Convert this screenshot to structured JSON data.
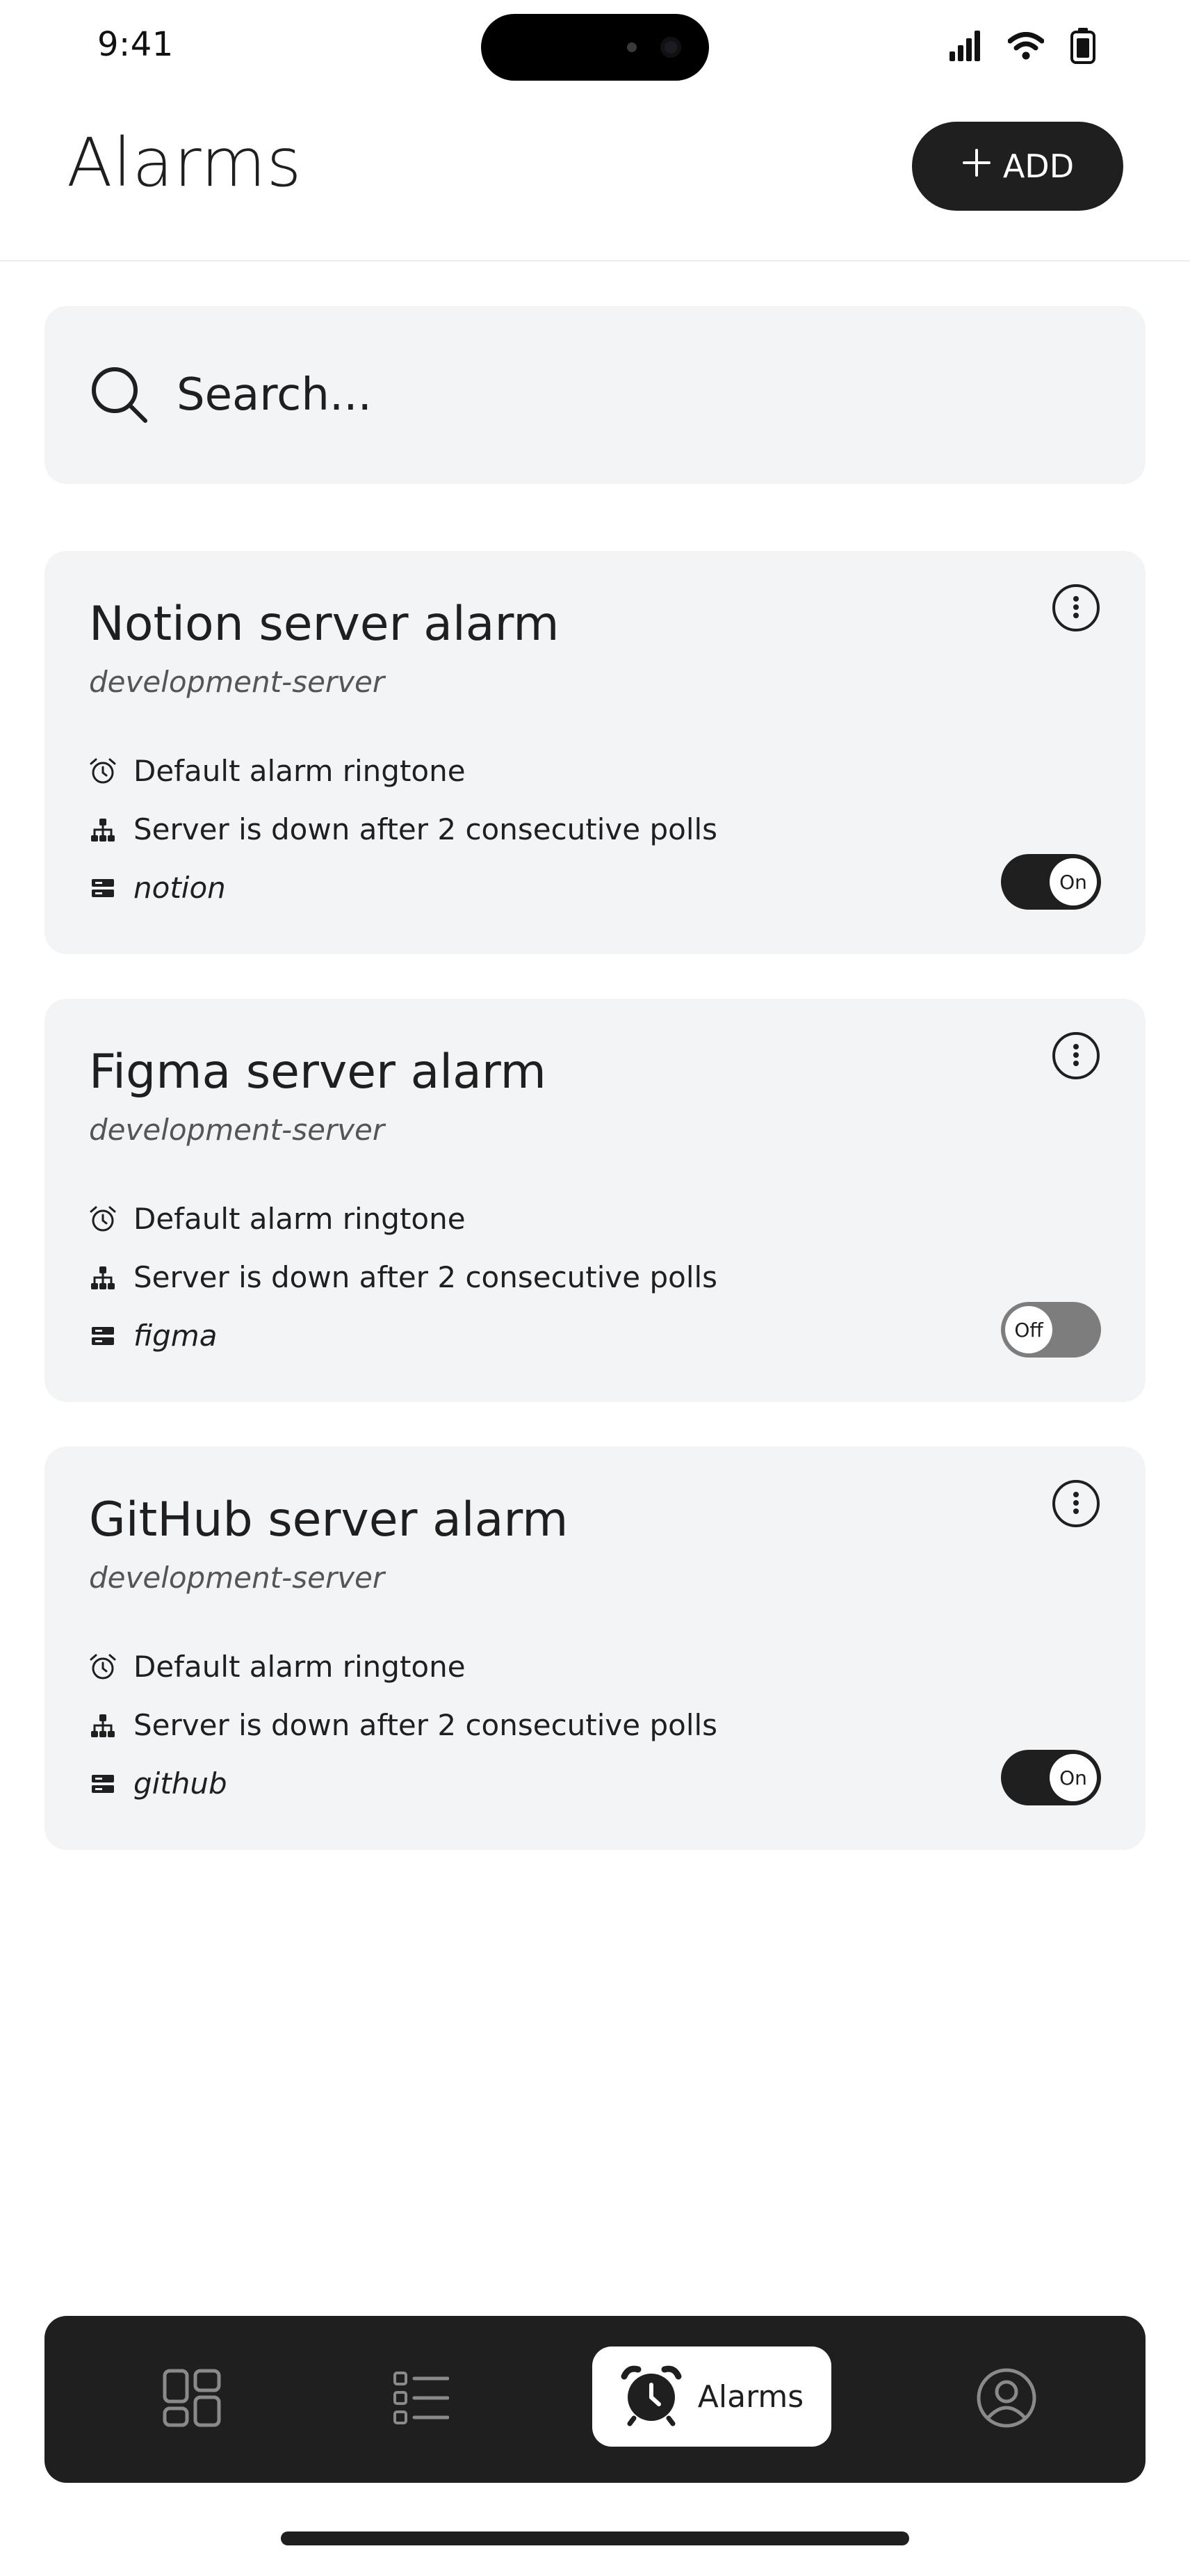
{
  "status_bar": {
    "time": "9:41",
    "icons": [
      "signal-icon",
      "wifi-icon",
      "battery-icon"
    ]
  },
  "header": {
    "title": "Alarms",
    "add_label": "ADD"
  },
  "search": {
    "placeholder": "Search..."
  },
  "alarms": [
    {
      "title": "Notion server alarm",
      "subtitle": "development-server",
      "ringtone": "Default alarm ringtone",
      "condition": "Server is down after 2 consecutive polls",
      "source": "notion",
      "enabled": true,
      "toggle_label": "On"
    },
    {
      "title": "Figma server alarm",
      "subtitle": "development-server",
      "ringtone": "Default alarm ringtone",
      "condition": "Server is down after 2 consecutive polls",
      "source": "figma",
      "enabled": false,
      "toggle_label": "Off"
    },
    {
      "title": "GitHub server alarm",
      "subtitle": "development-server",
      "ringtone": "Default alarm ringtone",
      "condition": "Server is down after 2 consecutive polls",
      "source": "github",
      "enabled": true,
      "toggle_label": "On"
    }
  ],
  "bottom_nav": {
    "items": [
      {
        "icon": "dashboard-icon",
        "label": ""
      },
      {
        "icon": "list-icon",
        "label": ""
      },
      {
        "icon": "alarm-clock-icon",
        "label": "Alarms",
        "active": true
      },
      {
        "icon": "profile-icon",
        "label": ""
      }
    ]
  },
  "colors": {
    "primary_dark": "#1f1f1f",
    "card_background": "#f3f4f6",
    "toggle_off": "#7d7d7d",
    "background": "#ffffff"
  }
}
